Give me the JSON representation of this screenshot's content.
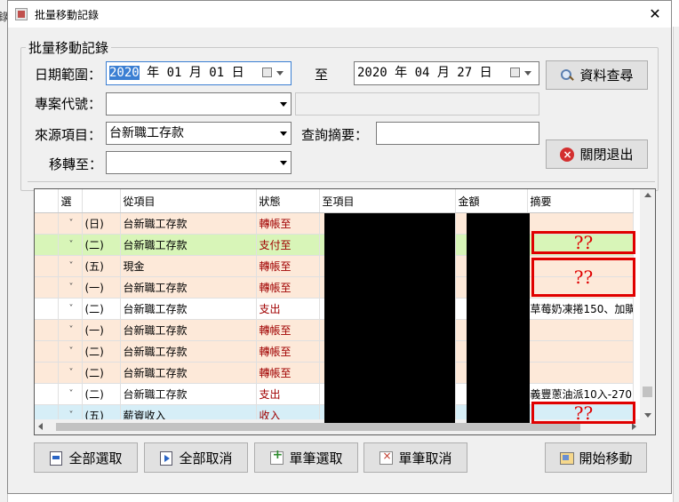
{
  "background": {
    "left_char": "錄"
  },
  "window": {
    "title": "批量移動記錄",
    "close_glyph": "✕"
  },
  "form": {
    "group_title": "批量移動記錄",
    "date_range_label": "日期範圍：",
    "date_from": {
      "year": "2020",
      "rest": " 年 01 月 01 日"
    },
    "to_label": "至",
    "date_to": "2020 年 04 月 27 日",
    "project_code_label": "專案代號：",
    "project_code_value": "",
    "project_desc_value": "",
    "source_label": "來源項目：",
    "source_value": "台新職工存款",
    "summary_query_label": "查詢摘要：",
    "summary_query_value": "",
    "move_to_label": "移轉至：",
    "move_to_value": ""
  },
  "buttons": {
    "query": "資料查尋",
    "close_exit": "關閉退出",
    "select_all": "全部選取",
    "cancel_all": "全部取消",
    "select_single": "單筆選取",
    "cancel_single": "單筆取消",
    "start_move": "開始移動"
  },
  "grid": {
    "columns": [
      "",
      "選",
      "",
      "從項目",
      "狀態",
      "至項目",
      "金額",
      "摘要"
    ],
    "rows": [
      {
        "check": "˅",
        "day": "(日)",
        "from": "台新職工存款",
        "status": "轉帳至",
        "to": "",
        "amount": "",
        "memo": "",
        "color": "peach"
      },
      {
        "check": "˅",
        "day": "(二)",
        "from": "台新職工存款",
        "status": "支付至",
        "to": "",
        "amount": "",
        "memo": "",
        "color": "green"
      },
      {
        "check": "˅",
        "day": "(五)",
        "from": "現金",
        "status": "轉帳至",
        "to": "",
        "amount": "",
        "memo": "",
        "color": "peach"
      },
      {
        "check": "˅",
        "day": "(一)",
        "from": "台新職工存款",
        "status": "轉帳至",
        "to": "",
        "amount": "",
        "memo": "",
        "color": "peach"
      },
      {
        "check": "˅",
        "day": "(二)",
        "from": "台新職工存款",
        "status": "支出",
        "to": "",
        "amount": "",
        "memo": "草莓奶凍捲150、加購.",
        "color": "white"
      },
      {
        "check": "˅",
        "day": "(一)",
        "from": "台新職工存款",
        "status": "轉帳至",
        "to": "",
        "amount": "",
        "memo": "",
        "color": "peach"
      },
      {
        "check": "˅",
        "day": "(二)",
        "from": "台新職工存款",
        "status": "轉帳至",
        "to": "",
        "amount": "",
        "memo": "",
        "color": "peach"
      },
      {
        "check": "˅",
        "day": "(二)",
        "from": "台新職工存款",
        "status": "轉帳至",
        "to": "",
        "amount": "",
        "memo": "",
        "color": "peach"
      },
      {
        "check": "˅",
        "day": "(二)",
        "from": "台新職工存款",
        "status": "支出",
        "to": "",
        "amount": "",
        "memo": "義豐蔥油派10入-270",
        "color": "white"
      },
      {
        "check": "˅",
        "day": "(五)",
        "from": "薪資收入",
        "status": "收入",
        "to": "",
        "amount": "",
        "memo": "",
        "color": "blue"
      }
    ]
  },
  "annotations": {
    "mark1": "??",
    "mark2": "??",
    "mark3": "??"
  },
  "colors": {
    "peach_row": "#fde9d9",
    "green_row": "#d8f5b8",
    "blue_row": "#d6eef7",
    "status_text": "#a00000",
    "annotation_red": "#e00000",
    "selection_blue": "#3b7fd3"
  }
}
